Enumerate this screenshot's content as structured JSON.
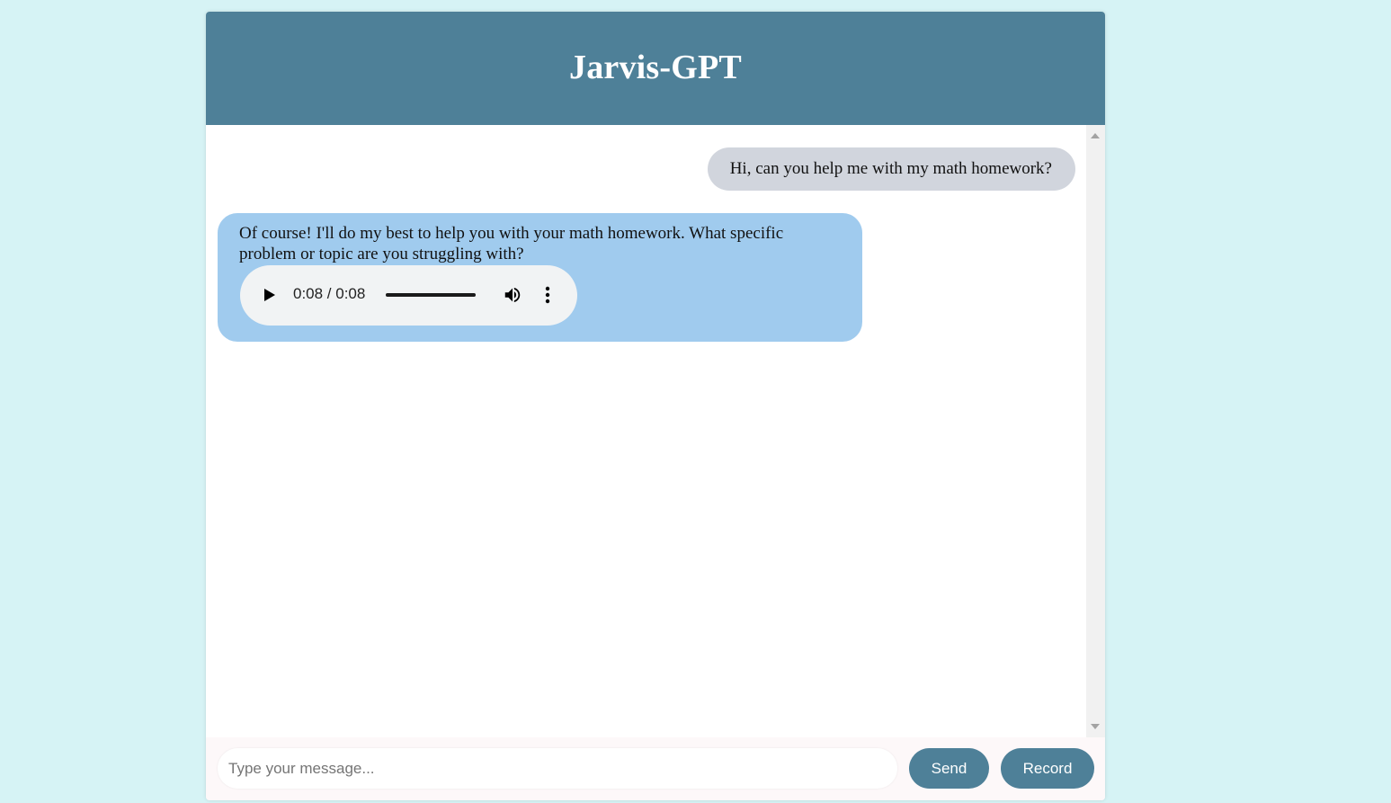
{
  "app": {
    "title": "Jarvis-GPT",
    "colors": {
      "page_background": "#d6f3f5",
      "header": "#4e8098",
      "user_bubble": "#d1d5dd",
      "bot_bubble": "#a0cbee",
      "button": "#4e8098"
    }
  },
  "chat": {
    "messages": [
      {
        "role": "user",
        "text": "Hi, can you help me with my math homework?"
      },
      {
        "role": "assistant",
        "text": "Of course! I'll do my best to help you with your math homework. What specific problem or topic are you struggling with?",
        "audio": {
          "time_display": "0:08 / 0:08",
          "progress": 1.0,
          "icons": [
            "play-icon",
            "volume-icon",
            "more-options-icon"
          ]
        }
      }
    ]
  },
  "composer": {
    "input_value": "",
    "input_placeholder": "Type your message...",
    "send_label": "Send",
    "record_label": "Record"
  }
}
